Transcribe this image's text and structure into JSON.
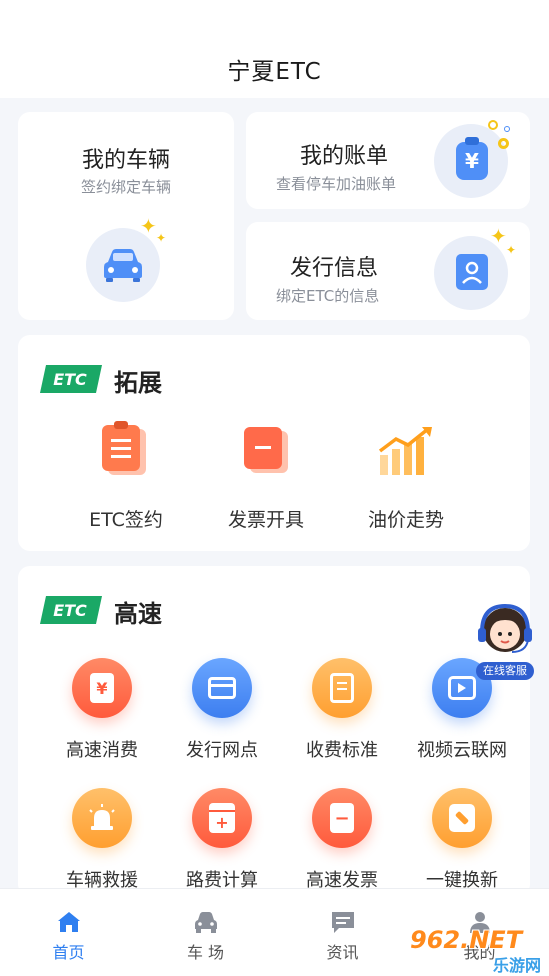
{
  "header": {
    "title": "宁夏ETC"
  },
  "cards": {
    "vehicle": {
      "title": "我的车辆",
      "subtitle": "签约绑定车辆"
    },
    "bill": {
      "title": "我的账单",
      "subtitle": "查看停车加油账单",
      "icon_glyph": "¥"
    },
    "issue": {
      "title": "发行信息",
      "subtitle": "绑定ETC的信息"
    }
  },
  "extend": {
    "logo_text": "ETC",
    "title": "拓展",
    "items": [
      {
        "label": "ETC签约",
        "icon": "clipboard-icon"
      },
      {
        "label": "发票开具",
        "icon": "invoice-icon"
      },
      {
        "label": "油价走势",
        "icon": "trend-chart-icon"
      }
    ]
  },
  "highway": {
    "logo_text": "ETC",
    "title": "高速",
    "items": [
      {
        "label": "高速消费",
        "icon": "yen-receipt-icon",
        "glyph": "¥"
      },
      {
        "label": "发行网点",
        "icon": "card-icon",
        "glyph": ""
      },
      {
        "label": "收费标准",
        "icon": "document-icon",
        "glyph": ""
      },
      {
        "label": "视频云联网",
        "icon": "video-icon",
        "glyph": ""
      },
      {
        "label": "车辆救援",
        "icon": "siren-icon",
        "glyph": ""
      },
      {
        "label": "路费计算",
        "icon": "calculator-icon",
        "glyph": "+"
      },
      {
        "label": "高速发票",
        "icon": "receipt-icon",
        "glyph": "−"
      },
      {
        "label": "一键换新",
        "icon": "wrench-icon",
        "glyph": ""
      }
    ]
  },
  "service": {
    "label": "在线客服"
  },
  "tabbar": {
    "tabs": [
      {
        "label": "首页",
        "active": true
      },
      {
        "label": "车 场",
        "active": false
      },
      {
        "label": "资讯",
        "active": false
      },
      {
        "label": "我的",
        "active": false
      }
    ]
  },
  "watermark": {
    "brand": "962.NET",
    "sub": "乐游网"
  },
  "colors": {
    "accent": "#2f7ff0",
    "etc_green": "#1aa866",
    "orange": "#ff7a4d",
    "blue": "#4f8ff7"
  }
}
